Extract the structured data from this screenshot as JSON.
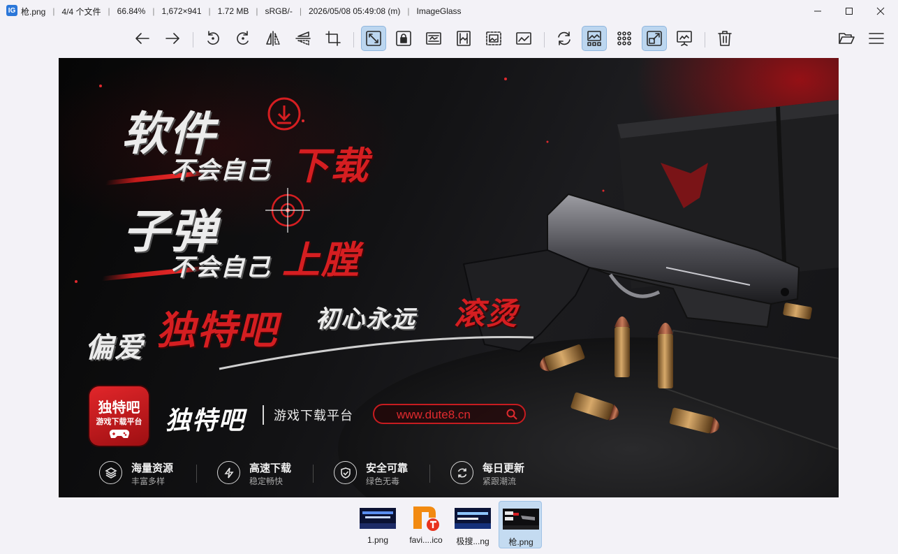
{
  "window": {
    "app_icon_text": "IG",
    "file_name": "枪.png",
    "file_index": "4/4 个文件",
    "zoom": "66.84%",
    "dimensions": "1,672×941",
    "file_size": "1.72 MB",
    "color_profile": "sRGB/-",
    "modified": "2026/05/08 05:49:08 (m)",
    "app_name": "ImageGlass",
    "separator": "|"
  },
  "toolbar": {
    "buttons": [
      {
        "name": "previous-image-button",
        "icon": "arrow-left-icon",
        "active": false
      },
      {
        "name": "next-image-button",
        "icon": "arrow-right-icon",
        "active": false
      },
      {
        "name": "rotate-left-button",
        "icon": "rotate-left-icon",
        "active": false
      },
      {
        "name": "rotate-right-button",
        "icon": "rotate-right-icon",
        "active": false
      },
      {
        "name": "flip-horizontal-button",
        "icon": "flip-horizontal-icon",
        "active": false
      },
      {
        "name": "flip-vertical-button",
        "icon": "flip-vertical-icon",
        "active": false
      },
      {
        "name": "crop-button",
        "icon": "crop-icon",
        "active": false
      },
      {
        "name": "auto-zoom-button",
        "icon": "auto-zoom-icon",
        "active": true
      },
      {
        "name": "lock-zoom-button",
        "icon": "lock-zoom-icon",
        "active": false
      },
      {
        "name": "scale-to-width-button",
        "icon": "scale-width-icon",
        "active": false
      },
      {
        "name": "scale-to-height-button",
        "icon": "scale-height-icon",
        "active": false
      },
      {
        "name": "scale-to-fit-button",
        "icon": "scale-fit-icon",
        "active": false
      },
      {
        "name": "scale-to-fill-button",
        "icon": "scale-fill-icon",
        "active": false
      },
      {
        "name": "refresh-button",
        "icon": "refresh-icon",
        "active": false
      },
      {
        "name": "toggle-gallery-button",
        "icon": "gallery-icon",
        "active": true
      },
      {
        "name": "toggle-checkerboard-button",
        "icon": "grid-icon",
        "active": false
      },
      {
        "name": "toggle-window-fit-button",
        "icon": "window-fit-icon",
        "active": true
      },
      {
        "name": "slideshow-button",
        "icon": "slideshow-icon",
        "active": false
      },
      {
        "name": "delete-button",
        "icon": "trash-icon",
        "active": false
      },
      {
        "name": "open-file-button",
        "icon": "folder-open-icon",
        "active": false
      },
      {
        "name": "main-menu-button",
        "icon": "hamburger-menu-icon",
        "active": false
      }
    ]
  },
  "image": {
    "headline_1a": "软件",
    "headline_1b": "不会自己",
    "headline_1c": "下载",
    "headline_2a": "子弹",
    "headline_2b": "不会自己",
    "headline_2c": "上膛",
    "slogan_a": "偏爱",
    "slogan_b": "独特吧",
    "slogan_c": "初心永远",
    "slogan_d": "滚烫",
    "logo_line1": "独特吧",
    "logo_line2": "游戏下载平台",
    "brand_name": "独特吧",
    "brand_sub": "游戏下载平台",
    "url": "www.dute8.cn",
    "features": [
      {
        "title": "海量资源",
        "sub": "丰富多样",
        "icon": "layers-icon"
      },
      {
        "title": "高速下载",
        "sub": "稳定畅快",
        "icon": "lightning-icon"
      },
      {
        "title": "安全可靠",
        "sub": "绿色无毒",
        "icon": "shield-icon"
      },
      {
        "title": "每日更新",
        "sub": "紧跟潮流",
        "icon": "refresh-icon"
      }
    ],
    "colors": {
      "accent_red": "#d51e21",
      "background": "#0e0e10"
    }
  },
  "gallery": {
    "thumbnails": [
      {
        "label": "1.png",
        "active": false
      },
      {
        "label": "favi....ico",
        "active": false
      },
      {
        "label": "极搜...ng",
        "active": false
      },
      {
        "label": "枪.png",
        "active": true
      }
    ]
  },
  "theme": {
    "window_bg": "#f3f2f7",
    "active_button_bg": "#bcd6ef"
  }
}
